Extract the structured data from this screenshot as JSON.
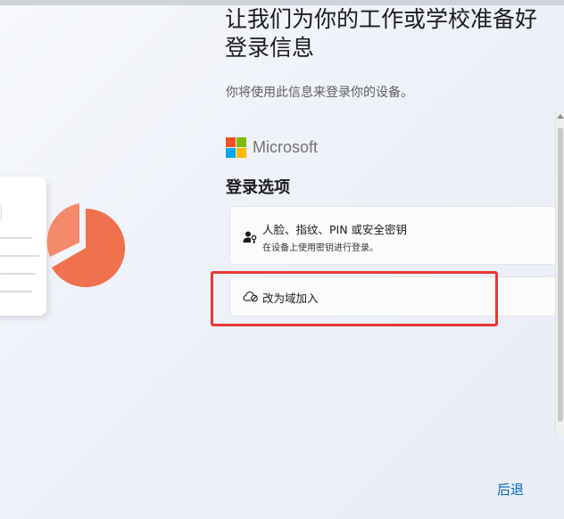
{
  "page": {
    "title": "让我们为你的工作或学校准备好登录信息",
    "subtitle": "你将使用此信息来登录你的设备。"
  },
  "brand": {
    "name": "Microsoft",
    "colors": [
      "#f25022",
      "#7fba00",
      "#00a4ef",
      "#ffb900"
    ]
  },
  "sign_in": {
    "section_title": "登录选项",
    "options": [
      {
        "icon": "person-key-icon",
        "title": "人脸、指纹、PIN 或安全密钥",
        "description": "在设备上使用密钥进行登录。"
      },
      {
        "icon": "cloud-blocked-icon",
        "title": "改为域加入"
      }
    ]
  },
  "footer": {
    "back_label": "后退"
  },
  "theme": {
    "accent": "#0067c0",
    "highlight": "#e53935",
    "pie": "#f0714e"
  }
}
